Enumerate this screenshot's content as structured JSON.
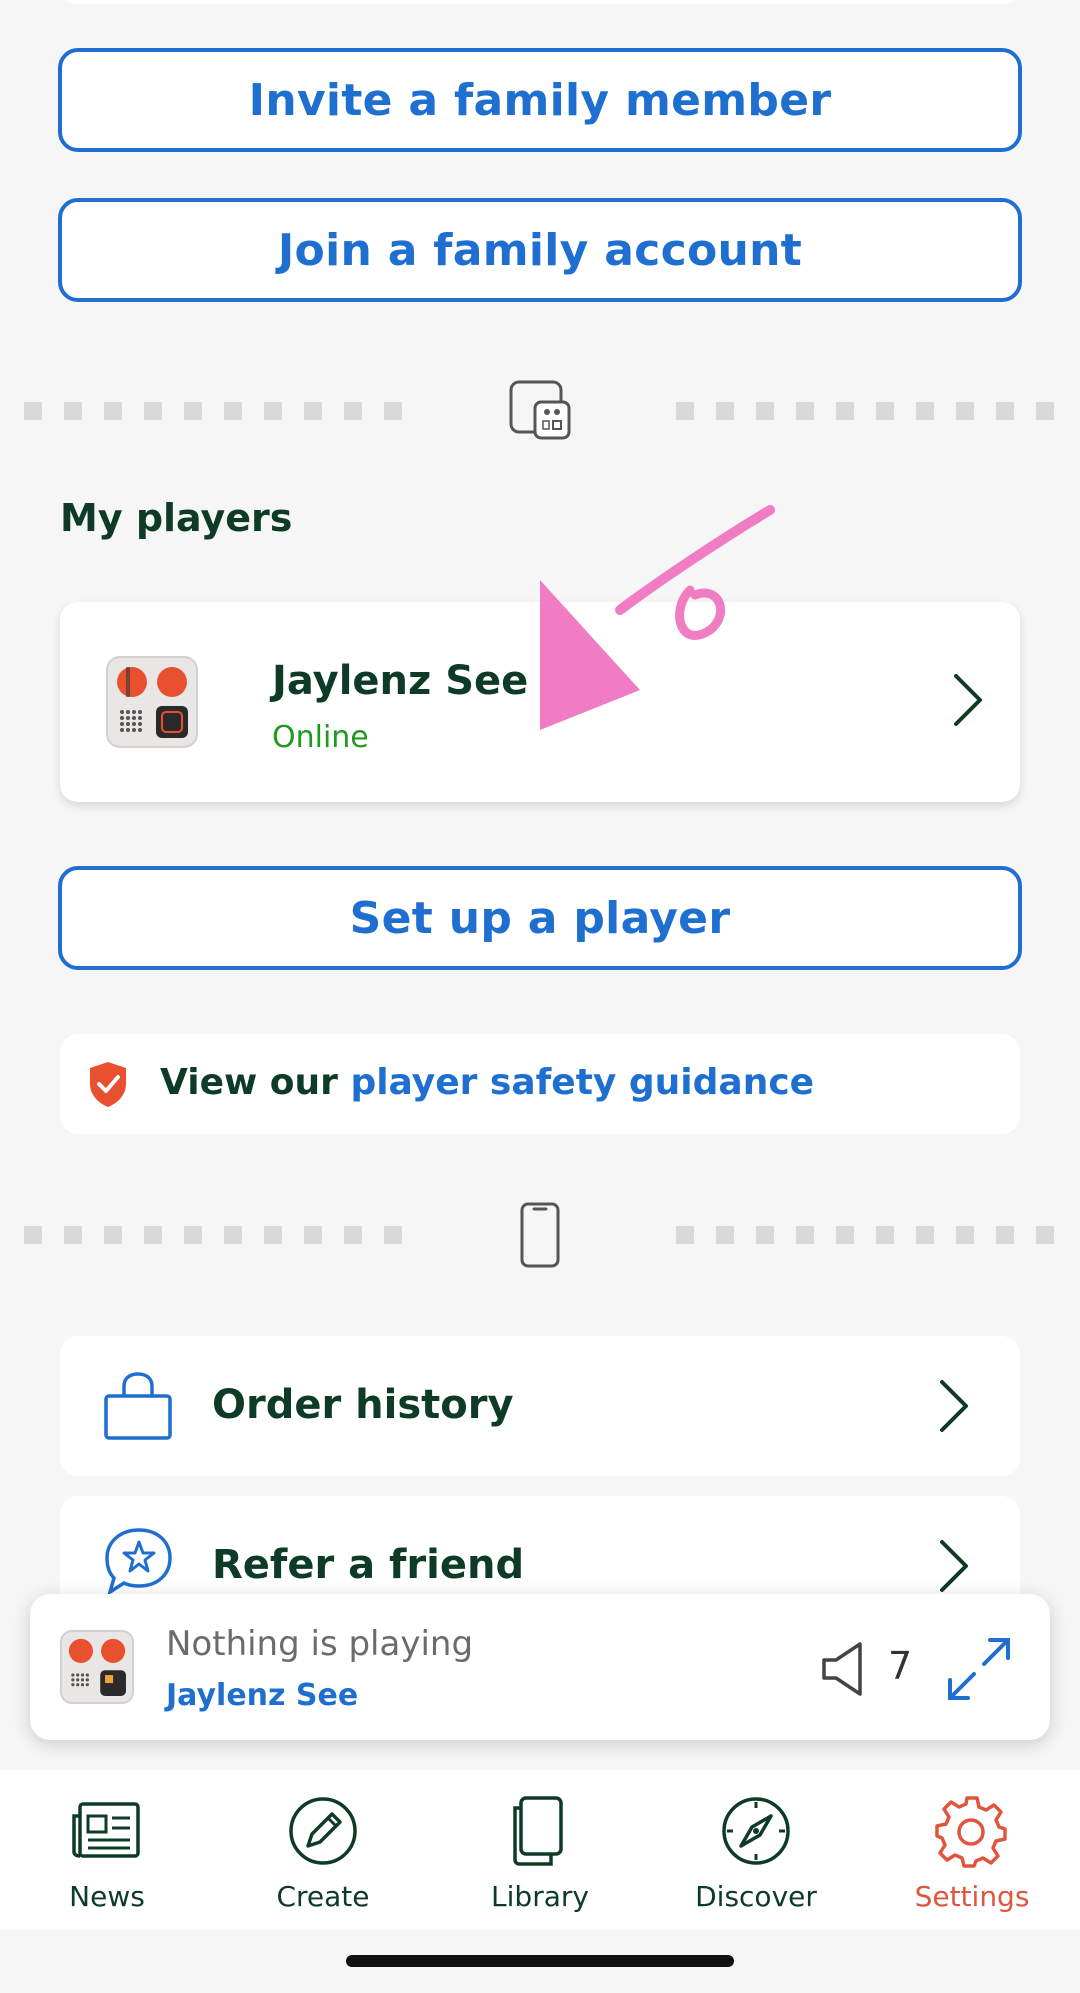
{
  "buttons": {
    "invite": "Invite a family member",
    "join": "Join a family account",
    "setup": "Set up a player"
  },
  "my_players": {
    "title": "My players",
    "players": [
      {
        "name": "Jaylenz See",
        "status": "Online"
      }
    ]
  },
  "safety": {
    "prefix": "View our ",
    "link": "player safety guidance"
  },
  "menu": [
    {
      "label": "Order history",
      "icon": "shopping-bag-icon"
    },
    {
      "label": "Refer a friend",
      "icon": "star-chat-icon"
    }
  ],
  "mini_player": {
    "status": "Nothing is playing",
    "player": "Jaylenz See",
    "volume": "7"
  },
  "tabs": [
    {
      "label": "News",
      "icon": "newspaper-icon"
    },
    {
      "label": "Create",
      "icon": "pencil-circle-icon"
    },
    {
      "label": "Library",
      "icon": "cards-icon"
    },
    {
      "label": "Discover",
      "icon": "compass-icon"
    },
    {
      "label": "Settings",
      "icon": "gear-icon",
      "active": true
    }
  ],
  "colors": {
    "accent_blue": "#1f6fd0",
    "text_dark_green": "#0e3b25",
    "online_green": "#1f9a1f",
    "active_tab": "#e0553e",
    "annotation_pink": "#f07cc4"
  }
}
